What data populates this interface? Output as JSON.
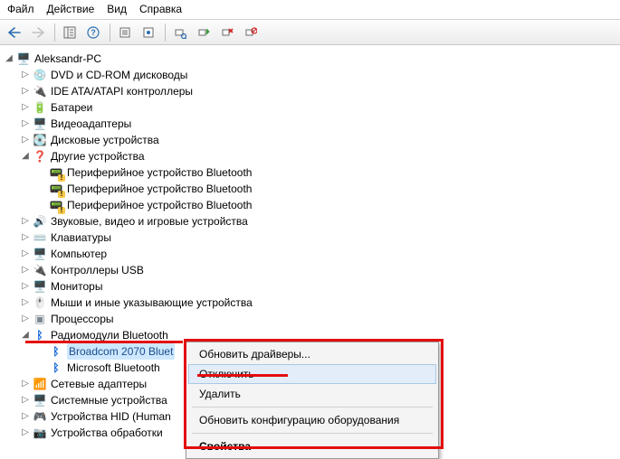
{
  "menu": {
    "file": "Файл",
    "action": "Действие",
    "view": "Вид",
    "help": "Справка"
  },
  "tree": {
    "root": "Aleksandr-PC",
    "dvd": "DVD и CD-ROM дисководы",
    "ide": "IDE ATA/ATAPI контроллеры",
    "battery": "Батареи",
    "video": "Видеоадаптеры",
    "disk": "Дисковые устройства",
    "other": "Другие устройства",
    "bt_periph1": "Периферийное устройство Bluetooth",
    "bt_periph2": "Периферийное устройство Bluetooth",
    "bt_periph3": "Периферийное устройство Bluetooth",
    "sound": "Звуковые, видео и игровые устройства",
    "keyboards": "Клавиатуры",
    "computer": "Компьютер",
    "usb": "Контроллеры USB",
    "monitors": "Мониторы",
    "mice": "Мыши и иные указывающие устройства",
    "cpu": "Процессоры",
    "bt_radio": "Радиомодули Bluetooth",
    "broadcom": "Broadcom 2070 Bluet",
    "ms_bt": "Microsoft Bluetooth",
    "net": "Сетевые адаптеры",
    "sysdev": "Системные устройства",
    "hid": "Устройства HID (Human",
    "imaging": "Устройства обработки"
  },
  "context": {
    "update": "Обновить драйверы...",
    "disable": "Отключить",
    "delete": "Удалить",
    "refresh": "Обновить конфигурацию оборудования",
    "props": "Свойства"
  }
}
